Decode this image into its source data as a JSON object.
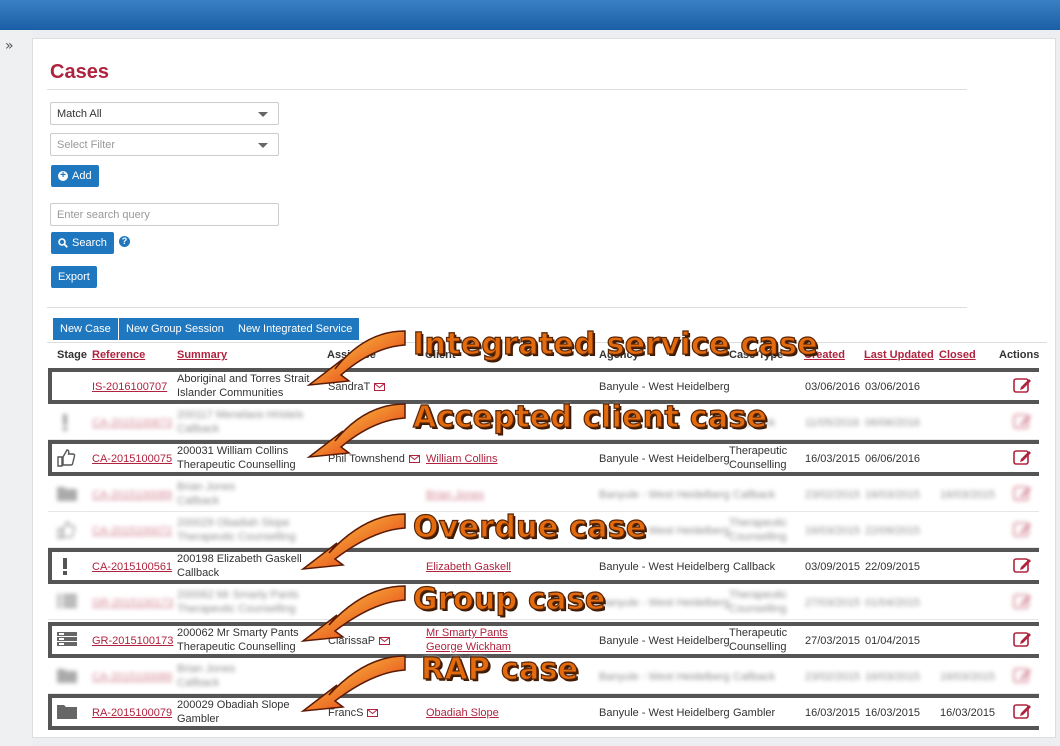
{
  "page": {
    "title": "Cases"
  },
  "filters": {
    "match": "Match All",
    "filter_placeholder": "Select Filter",
    "add": "Add",
    "search_placeholder": "Enter search query",
    "search": "Search",
    "help": "?",
    "export": "Export"
  },
  "toolbar": {
    "new_case": "New Case",
    "new_group": "New Group Session",
    "new_integrated": "New Integrated Service"
  },
  "columns": {
    "stage": "Stage",
    "reference": "Reference",
    "summary": "Summary",
    "assignee": "Assignee",
    "client": "Client",
    "agency": "Agency",
    "case_type": "Case Type",
    "created": "Created",
    "last_updated": "Last Updated",
    "closed": "Closed",
    "actions": "Actions"
  },
  "rows": [
    {
      "stage_icon": "empty-icon",
      "ref": "IS-2016100707",
      "sum1": "Aboriginal and Torres Strait",
      "sum2": "Islander Communities",
      "assignee": "SandraT",
      "client1": "",
      "client2": "",
      "agency": "Banyule - West Heidelberg",
      "type1": "",
      "type2": "",
      "created": "03/06/2016",
      "updated": "03/06/2016",
      "closed": ""
    },
    {
      "stage_icon": "exclamation-icon",
      "ref": "CA-2015100673",
      "sum1": "200117 Menelaos Hristeis",
      "sum2": "Callback",
      "assignee": "",
      "client1": "",
      "client2": "",
      "agency": "",
      "type1": "Callback",
      "type2": "",
      "created": "11/05/2016",
      "updated": "06/06/2016",
      "closed": ""
    },
    {
      "stage_icon": "thumbs-up-icon",
      "ref": "CA-2015100075",
      "sum1": "200031 William Collins",
      "sum2": "Therapeutic Counselling",
      "assignee": "Phil Townshend",
      "client1": "William Collins",
      "client2": "",
      "agency": "Banyule - West Heidelberg",
      "type1": "Therapeutic",
      "type2": "Counselling",
      "created": "16/03/2015",
      "updated": "06/06/2016",
      "closed": ""
    },
    {
      "stage_icon": "folder-icon",
      "ref": "CA-2015100089",
      "sum1": "Brian Jones",
      "sum2": "Callback",
      "assignee": "",
      "client1": "Brian Jones",
      "client2": "",
      "agency": "Banyule - West Heidelberg",
      "type1": "Callback",
      "type2": "",
      "created": "23/02/2015",
      "updated": "16/03/2015",
      "closed": "16/03/2015"
    },
    {
      "stage_icon": "thumbs-up-icon",
      "ref": "CA-2015100072",
      "sum1": "200029 Obadiah Slope",
      "sum2": "Therapeutic Counselling",
      "assignee": "",
      "client1": "",
      "client2": "",
      "agency": "Banyule - West Heidelberg",
      "type1": "Therapeutic",
      "type2": "Counselling",
      "created": "16/03/2015",
      "updated": "22/09/2015",
      "closed": ""
    },
    {
      "stage_icon": "exclamation-icon",
      "ref": "CA-2015100561",
      "sum1": "200198 Elizabeth Gaskell",
      "sum2": "Callback",
      "assignee": "",
      "client1": "Elizabeth Gaskell",
      "client2": "",
      "agency": "Banyule - West Heidelberg",
      "type1": "Callback",
      "type2": "",
      "created": "03/09/2015",
      "updated": "22/09/2015",
      "closed": ""
    },
    {
      "stage_icon": "group-icon",
      "ref": "GR-2015100173",
      "sum1": "200062 Mr Smarty Pants",
      "sum2": "Therapeutic Counselling",
      "assignee": "",
      "client1": "",
      "client2": "",
      "agency": "Banyule - West Heidelberg",
      "type1": "Therapeutic",
      "type2": "Counselling",
      "created": "27/03/2015",
      "updated": "01/04/2015",
      "closed": ""
    },
    {
      "stage_icon": "group-icon",
      "ref": "GR-2015100173",
      "sum1": "200062 Mr Smarty Pants",
      "sum2": "Therapeutic Counselling",
      "assignee": "ClarissaP",
      "client1": "Mr Smarty Pants",
      "client2": "George Wickham",
      "agency": "Banyule - West Heidelberg",
      "type1": "Therapeutic",
      "type2": "Counselling",
      "created": "27/03/2015",
      "updated": "01/04/2015",
      "closed": ""
    },
    {
      "stage_icon": "folder-icon",
      "ref": "CA-2015100089",
      "sum1": "Brian Jones",
      "sum2": "Callback",
      "assignee": "",
      "client1": "",
      "client2": "",
      "agency": "Banyule - West Heidelberg",
      "type1": "Callback",
      "type2": "",
      "created": "23/02/2015",
      "updated": "16/03/2015",
      "closed": "16/03/2015"
    },
    {
      "stage_icon": "folder-icon",
      "ref": "RA-2015100079",
      "sum1": "200029 Obadiah Slope",
      "sum2": "Gambler",
      "assignee": "FrancS",
      "client1": "Obadiah Slope",
      "client2": "",
      "agency": "Banyule - West Heidelberg",
      "type1": "Gambler",
      "type2": "",
      "created": "16/03/2015",
      "updated": "16/03/2015",
      "closed": "16/03/2015"
    }
  ],
  "annotations": {
    "a1": "Integrated service case",
    "a2": "Accepted client case",
    "a3": "Overdue case",
    "a4": "Group case",
    "a5": "RAP case"
  },
  "colors": {
    "accent": "#b0233e",
    "primary": "#1f78bf",
    "annotation": "#e36a0d"
  }
}
